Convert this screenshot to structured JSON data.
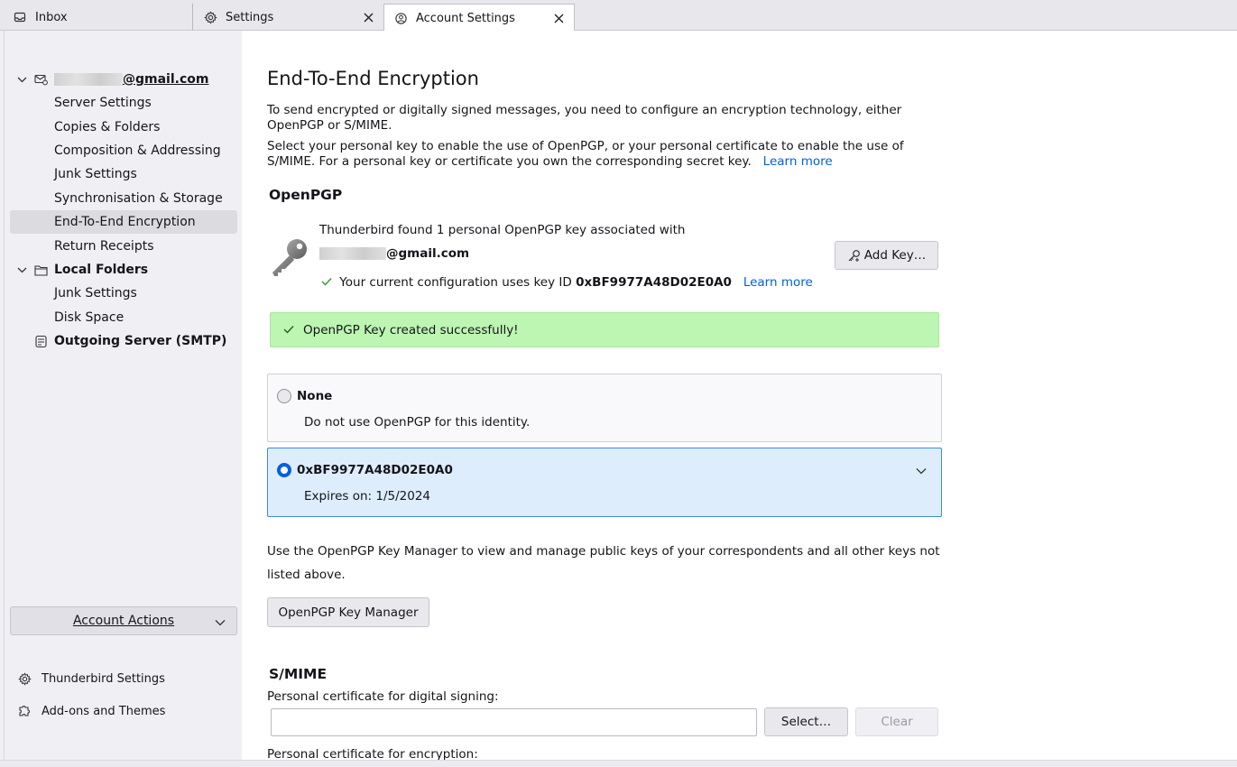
{
  "tabs": [
    {
      "label": "Inbox",
      "icon": "inbox-icon"
    },
    {
      "label": "Settings",
      "icon": "gear-icon"
    },
    {
      "label": "Account Settings",
      "icon": "account-settings-icon"
    }
  ],
  "sidebar": {
    "account_email_suffix": "@gmail.com",
    "account_items": [
      "Server Settings",
      "Copies & Folders",
      "Composition & Addressing",
      "Junk Settings",
      "Synchronisation & Storage",
      "End-To-End Encryption",
      "Return Receipts"
    ],
    "local_folders": "Local Folders",
    "local_items": [
      "Junk Settings",
      "Disk Space"
    ],
    "outgoing_server": "Outgoing Server (SMTP)",
    "account_actions": "Account Actions",
    "thunderbird_settings": "Thunderbird Settings",
    "addons": "Add-ons and Themes"
  },
  "main": {
    "title": "End-To-End Encryption",
    "intro1": "To send encrypted or digitally signed messages, you need to configure an encryption technology, either OpenPGP or S/MIME.",
    "intro2": "Select your personal key to enable the use of OpenPGP, or your personal certificate to enable the use of S/MIME. For a personal key or certificate you own the corresponding secret key.",
    "learn_more": "Learn more",
    "openpgp_title": "OpenPGP",
    "found_text": "Thunderbird found 1 personal OpenPGP key associated with",
    "email_suffix": "@gmail.com",
    "config_text": "Your current configuration uses key ID",
    "key_id": "0xBF9977A48D02E0A0",
    "add_key": "Add Key…",
    "success": "OpenPGP Key created successfully!",
    "none_label": "None",
    "none_sub": "Do not use OpenPGP for this identity.",
    "key_label": "0xBF9977A48D02E0A0",
    "key_expires": "Expires on: 1/5/2024",
    "manager_text": "Use the OpenPGP Key Manager to view and manage public keys of your correspondents and all other keys not listed above.",
    "key_manager": "OpenPGP Key Manager",
    "smime_title": "S/MIME",
    "signing_label": "Personal certificate for digital signing:",
    "signing_value": "",
    "select": "Select…",
    "clear": "Clear",
    "encryption_label": "Personal certificate for encryption:"
  },
  "colors": {
    "accent": "#0060df",
    "success_bg": "#bdf5b3",
    "selected_box_bg": "#deedfc"
  }
}
